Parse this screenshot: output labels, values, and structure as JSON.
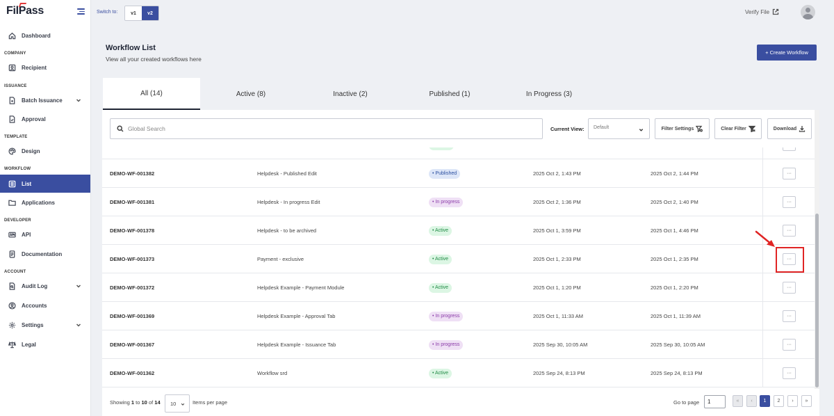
{
  "brand": {
    "name_prefix": "Fil",
    "name_p": "P",
    "name_suffix": "ass"
  },
  "topbar": {
    "switch_label": "Switch to:",
    "v1": "v1",
    "v2": "v2",
    "verify": "Verify File"
  },
  "sidebar": {
    "dashboard": "Dashboard",
    "company": "Company",
    "recipient": "Recipient",
    "issuance": "Issuance",
    "batch": "Batch Issuance",
    "approval": "Approval",
    "template": "Template",
    "design": "Design",
    "workflow": "Workflow",
    "list": "List",
    "applications": "Applications",
    "developer": "Developer",
    "api": "API",
    "documentation": "Documentation",
    "account": "Account",
    "audit": "Audit Log",
    "accounts": "Accounts",
    "settings": "Settings",
    "legal": "Legal"
  },
  "header": {
    "title": "Workflow List",
    "subtitle": "View all your created workflows here",
    "create": "+ Create Workflow"
  },
  "tabs": [
    "All (14)",
    "Active (8)",
    "Inactive (2)",
    "Published (1)",
    "In Progress (3)"
  ],
  "toolbar": {
    "search_placeholder": "Global Search",
    "current_view": "Current View:",
    "view_value": "Default",
    "filter_settings": "Filter Settings",
    "clear_filter": "Clear Filter",
    "download": "Download"
  },
  "rows": [
    {
      "id": "DEMO-WF-001382",
      "name": "Helpdesk - Published Edit",
      "status": "Published",
      "created": "2025 Oct 2, 1:43 PM",
      "updated": "2025 Oct 2, 1:44 PM"
    },
    {
      "id": "DEMO-WF-001381",
      "name": "Helpdesk - In progress Edit",
      "status": "In progress",
      "created": "2025 Oct 2, 1:36 PM",
      "updated": "2025 Oct 2, 1:40 PM"
    },
    {
      "id": "DEMO-WF-001378",
      "name": "Helpdesk - to be archived",
      "status": "Active",
      "created": "2025 Oct 1, 3:59 PM",
      "updated": "2025 Oct 1, 4:46 PM"
    },
    {
      "id": "DEMO-WF-001373",
      "name": "Payment - exclusive",
      "status": "Active",
      "created": "2025 Oct 1, 2:33 PM",
      "updated": "2025 Oct 1, 2:35 PM"
    },
    {
      "id": "DEMO-WF-001372",
      "name": "Helpdesk Example - Payment Module",
      "status": "Active",
      "created": "2025 Oct 1, 1:20 PM",
      "updated": "2025 Oct 1, 2:20 PM"
    },
    {
      "id": "DEMO-WF-001369",
      "name": "Helpdesk Example - Approval Tab",
      "status": "In progress",
      "created": "2025 Oct 1, 11:33 AM",
      "updated": "2025 Oct 1, 11:39 AM"
    },
    {
      "id": "DEMO-WF-001367",
      "name": "Helpdesk Example - Issuance Tab",
      "status": "In progress",
      "created": "2025 Sep 30, 10:05 AM",
      "updated": "2025 Sep 30, 10:05 AM"
    },
    {
      "id": "DEMO-WF-001362",
      "name": "Workflow srd",
      "status": "Active",
      "created": "2025 Sep 24, 8:13 PM",
      "updated": "2025 Sep 24, 8:13 PM"
    }
  ],
  "row_action": "···",
  "footer": {
    "showing": "Showing",
    "from": "1",
    "to_word": "to",
    "to": "10",
    "of_word": "of",
    "total": "14",
    "per_page": "10",
    "items_per_page": "Items per page",
    "goto": "Go to page",
    "goto_value": "1",
    "first": "«",
    "prev": "‹",
    "page1": "1",
    "page2": "2",
    "next": "›",
    "last": "»"
  },
  "colors": {
    "accent": "#3a4ea0",
    "highlight": "#e02424"
  }
}
